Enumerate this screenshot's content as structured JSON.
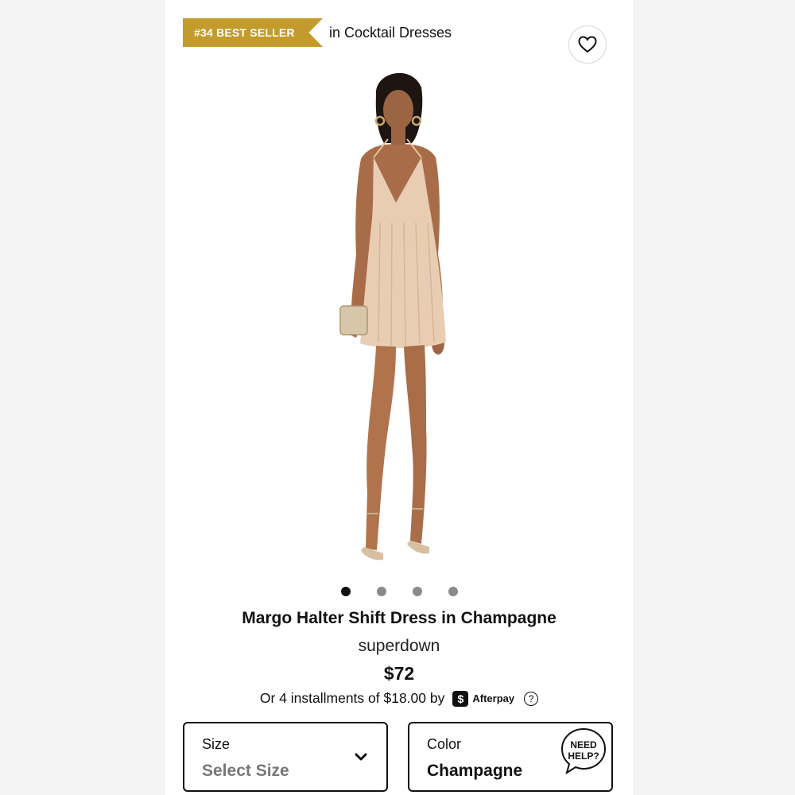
{
  "badge": {
    "rank": "#34 BEST SELLER",
    "category": "in Cocktail Dresses",
    "color": "#c39a2c"
  },
  "product": {
    "title": "Margo Halter Shift Dress in Champagne",
    "brand": "superdown",
    "price": "$72",
    "installments_text": "Or 4 installments of $18.00 by",
    "afterpay_label": "Afterpay",
    "help_glyph": "?"
  },
  "gallery": {
    "total": 4,
    "active_index": 0
  },
  "selectors": {
    "size": {
      "label": "Size",
      "value": "Select Size"
    },
    "color": {
      "label": "Color",
      "value": "Champagne"
    },
    "need_help": {
      "line1": "NEED",
      "line2": "HELP?"
    }
  },
  "icons": {
    "heart": "heart-icon",
    "afterpay": "afterpay-icon",
    "chevron": "chevron-down-icon"
  }
}
